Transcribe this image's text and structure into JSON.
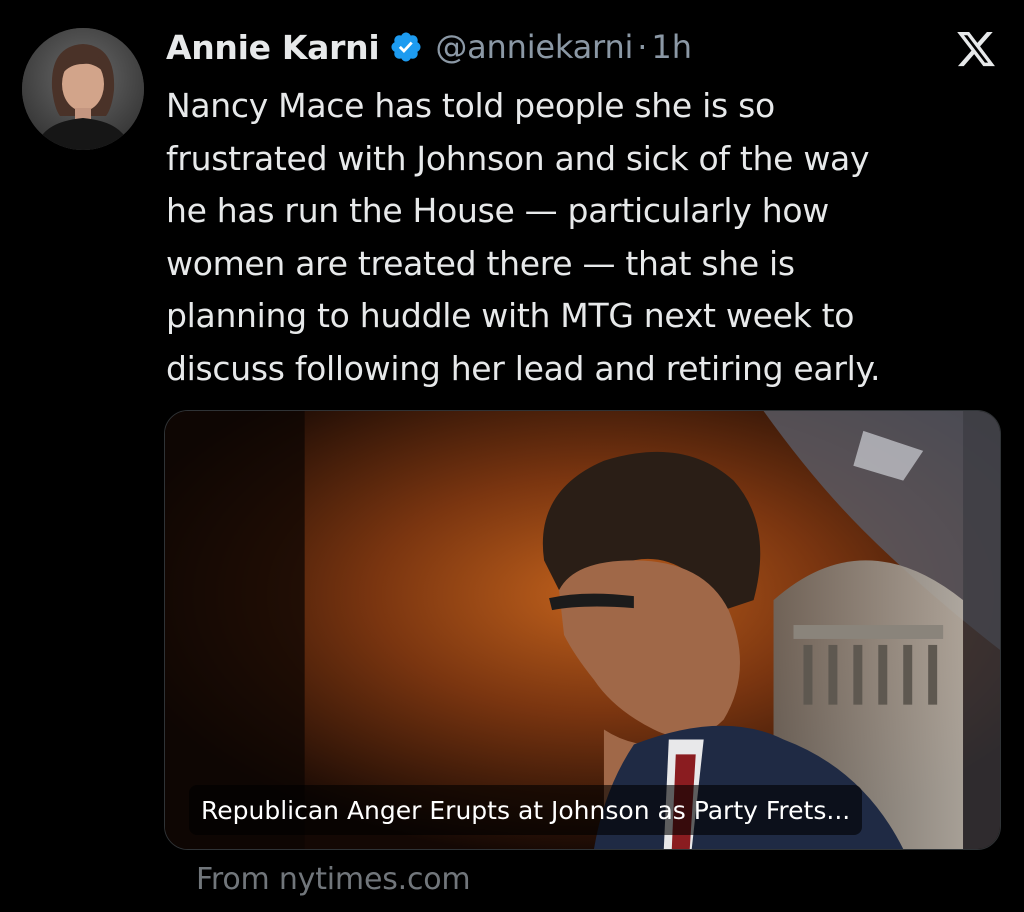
{
  "tweet": {
    "author_name": "Annie Karni",
    "handle": "@anniekarni",
    "separator": "·",
    "time": "1h",
    "verified_icon": "verified-badge-icon",
    "text_lines": [
      "Nancy Mace has told people she is so",
      "frustrated with Johnson and sick of the way",
      "he has run the House — particularly how",
      "women are treated there — that she is",
      "planning to huddle with MTG next week to",
      "discuss following her lead and retiring early."
    ]
  },
  "card": {
    "title": "Republican Anger Erupts at Johnson as Party Frets...",
    "source": "From nytimes.com"
  },
  "icons": {
    "platform_logo": "x-logo-icon",
    "avatar": "avatar"
  },
  "colors": {
    "background": "#000000",
    "text_primary": "#e7e9ea",
    "text_secondary": "#8b98a5",
    "verified_blue": "#1d9bf0"
  }
}
